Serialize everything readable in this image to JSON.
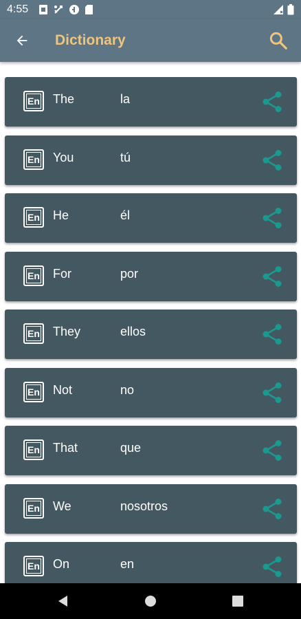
{
  "status_bar": {
    "time": "4:55",
    "left_icons": [
      "sim-card-icon",
      "usb-debug-icon",
      "data-saver-icon",
      "sd-card-icon"
    ],
    "right_icons": [
      "signal-icon",
      "battery-icon"
    ]
  },
  "app_bar": {
    "title": "Dictionary",
    "back_icon": "arrow-back-icon",
    "search_icon": "search-icon",
    "background_color": "#5d7584",
    "title_color": "#f0c47c"
  },
  "list": {
    "lang_badge": "En",
    "item_color": "#445862",
    "share_color": "#1a9a8f",
    "items": [
      {
        "word": "The",
        "translation": "la"
      },
      {
        "word": "You",
        "translation": "tú"
      },
      {
        "word": "He",
        "translation": "él"
      },
      {
        "word": "For",
        "translation": "por"
      },
      {
        "word": "They",
        "translation": "ellos"
      },
      {
        "word": "Not",
        "translation": "no"
      },
      {
        "word": "That",
        "translation": "que"
      },
      {
        "word": "We",
        "translation": "nosotros"
      },
      {
        "word": "On",
        "translation": "en"
      }
    ]
  },
  "nav_bar": {
    "buttons": [
      "back-triangle-icon",
      "home-circle-icon",
      "recents-square-icon"
    ]
  }
}
